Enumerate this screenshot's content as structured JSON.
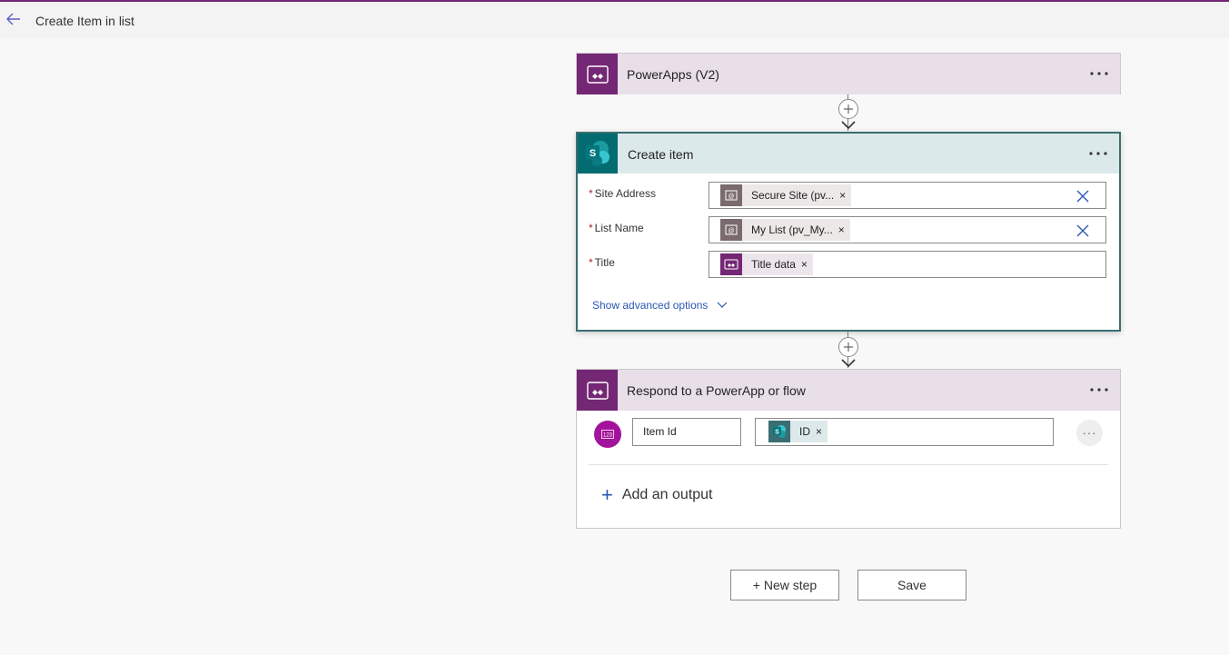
{
  "header": {
    "title": "Create Item in list",
    "back_icon": "back-arrow-icon"
  },
  "trigger": {
    "title": "PowerApps (V2)",
    "icon": "powerapps-icon",
    "more_label": "···"
  },
  "create_item": {
    "title": "Create item",
    "icon": "sharepoint-icon",
    "more_label": "···",
    "fields": [
      {
        "label": "Site Address",
        "required_mark": "*",
        "token": "Secure Site (pv...",
        "token_icon": "variable-icon",
        "token_remove": "×"
      },
      {
        "label": "List Name",
        "required_mark": "*",
        "token": "My List (pv_My...",
        "token_icon": "variable-icon",
        "token_remove": "×"
      },
      {
        "label": "Title",
        "required_mark": "*",
        "token": "Title data",
        "token_icon": "powerapps-icon",
        "token_remove": "×"
      }
    ],
    "advanced_label": "Show advanced options"
  },
  "respond": {
    "title": "Respond to a PowerApp or flow",
    "icon": "powerapps-icon",
    "more_label": "···",
    "output": {
      "name": "Item Id",
      "token": "ID",
      "token_icon": "sharepoint-icon",
      "token_remove": "×",
      "more_label": "···"
    },
    "add_output_icon": "+",
    "add_output_label": "Add an output"
  },
  "actions": {
    "new_step": "+ New step",
    "save": "Save"
  },
  "colors": {
    "powerapps": "#742774",
    "sharepoint": "#036c70",
    "link": "#2b57b5",
    "required": "#a4262c"
  }
}
